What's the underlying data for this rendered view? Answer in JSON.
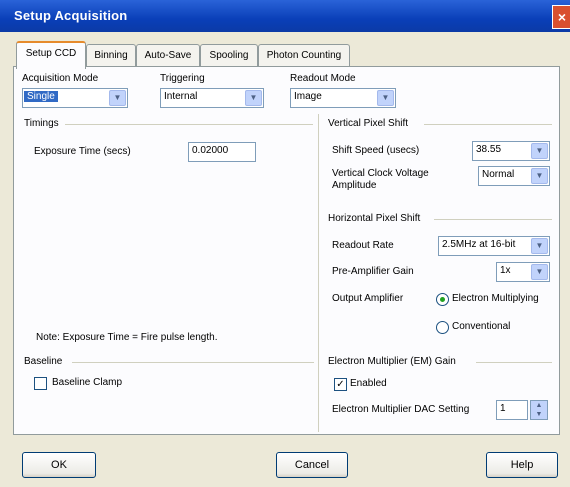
{
  "window": {
    "title": "Setup Acquisition",
    "close_glyph": "×"
  },
  "tabs": [
    {
      "label": "Setup CCD",
      "active": true
    },
    {
      "label": "Binning"
    },
    {
      "label": "Auto-Save"
    },
    {
      "label": "Spooling"
    },
    {
      "label": "Photon Counting"
    }
  ],
  "acquisition_mode": {
    "label": "Acquisition Mode",
    "value": "Single"
  },
  "triggering": {
    "label": "Triggering",
    "value": "Internal"
  },
  "readout_mode": {
    "label": "Readout Mode",
    "value": "Image"
  },
  "timings": {
    "title": "Timings",
    "exposure_label": "Exposure Time (secs)",
    "exposure_value": "0.02000",
    "note": "Note: Exposure Time = Fire pulse length."
  },
  "baseline": {
    "title": "Baseline",
    "clamp_label": "Baseline Clamp",
    "clamp_checked": false
  },
  "vertical_shift": {
    "title": "Vertical Pixel Shift",
    "speed_label": "Shift Speed (usecs)",
    "speed_value": "38.55",
    "clock_label": "Vertical Clock Voltage Amplitude",
    "clock_value": "Normal"
  },
  "horizontal_shift": {
    "title": "Horizontal Pixel Shift",
    "readout_rate_label": "Readout Rate",
    "readout_rate_value": "2.5MHz at 16-bit",
    "preamp_label": "Pre-Amplifier Gain",
    "preamp_value": "1x",
    "output_amp_label": "Output Amplifier",
    "opt_em": "Electron Multiplying",
    "opt_conv": "Conventional",
    "selected": "Electron Multiplying"
  },
  "em_gain": {
    "title": "Electron Multiplier (EM) Gain",
    "enabled_label": "Enabled",
    "enabled_checked": true,
    "dac_label": "Electron Multiplier DAC Setting",
    "dac_value": "1"
  },
  "buttons": {
    "ok": "OK",
    "cancel": "Cancel",
    "help": "Help"
  },
  "icons": {
    "dropdown": "▼",
    "spin_up": "▲",
    "spin_down": "▼",
    "check": "✓"
  }
}
